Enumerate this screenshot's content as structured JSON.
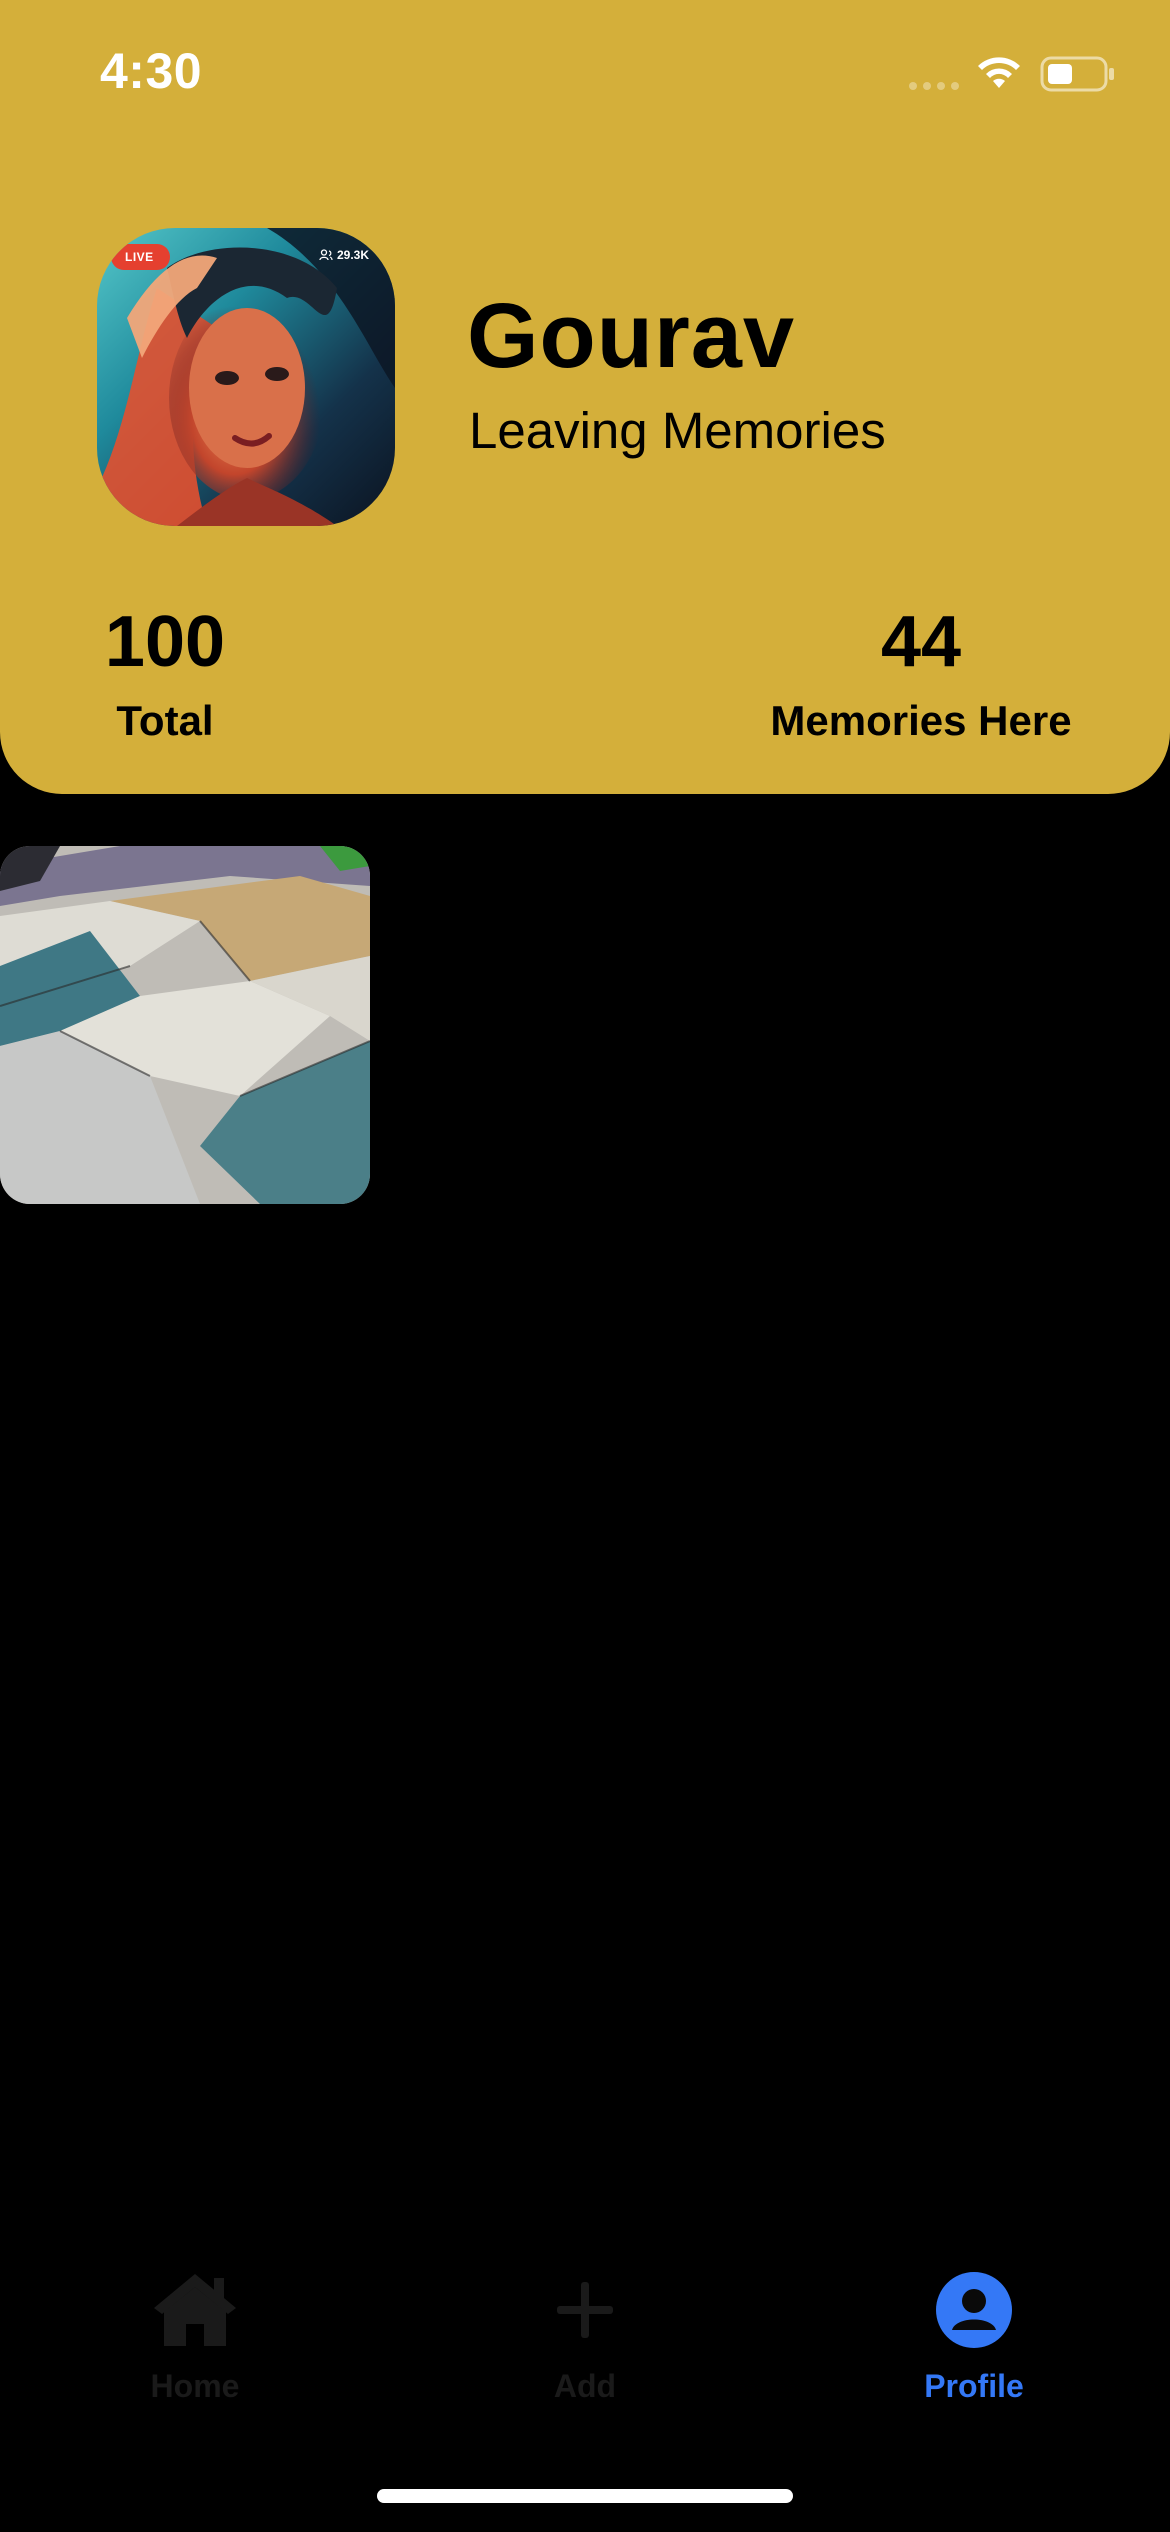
{
  "status_bar": {
    "time": "4:30"
  },
  "colors": {
    "header_background": "#d4af3a",
    "page_background": "#000000",
    "tab_active": "#3478f6",
    "tab_inactive": "#1a1a1a"
  },
  "profile": {
    "name": "Gourav",
    "subtitle": "Leaving Memories",
    "avatar": {
      "live_badge": "LIVE",
      "viewer_count": "29.3K"
    }
  },
  "stats": [
    {
      "value": "100",
      "label": "Total"
    },
    {
      "value": "44",
      "label": "Memories Here"
    }
  ],
  "memories": [
    {
      "description": "folded fabric swatches"
    }
  ],
  "tab_bar": {
    "tabs": [
      {
        "label": "Home",
        "icon": "house-icon",
        "active": false
      },
      {
        "label": "Add",
        "icon": "plus-icon",
        "active": false
      },
      {
        "label": "Profile",
        "icon": "person-circle-icon",
        "active": true
      }
    ]
  }
}
